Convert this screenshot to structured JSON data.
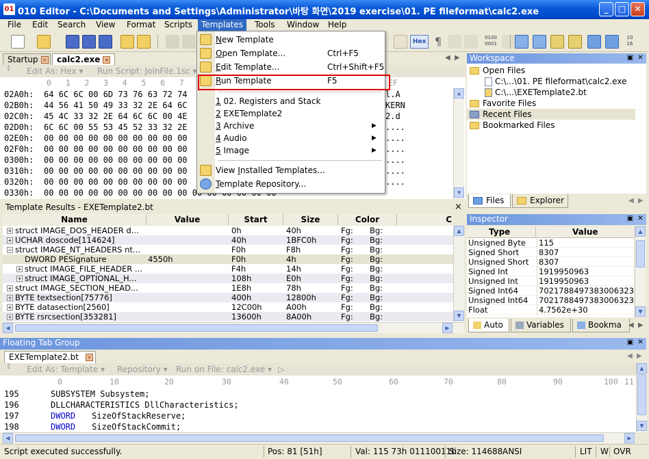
{
  "window": {
    "title": "010 Editor - C:\\Documents and Settings\\Administrator\\바탕 화면\\2019 exercise\\01. PE fileformat\\calc2.exe",
    "controls": {
      "min": "_",
      "max": "□",
      "close": "✕"
    }
  },
  "menubar": [
    "File",
    "Edit",
    "Search",
    "View",
    "Format",
    "Scripts",
    "Templates",
    "Tools",
    "Window",
    "Help"
  ],
  "toolbar": {
    "hex_label": "Hex"
  },
  "editor": {
    "tabs": [
      "Startup",
      "calc2.exe"
    ],
    "bar": {
      "edit_as": "Edit As: Hex ▾",
      "run_script": "Run Script: JoinFile.1sc ▾"
    },
    "columns": "0   1   2   3   4   5   6   7   8   9   A   B   C   D   E   F",
    "columns_text": "EF",
    "rows": [
      {
        "addr": "02A0h:",
        "bytes": "64 6C 6C 00 6D 73 76 63 72 74",
        "text": "l.A"
      },
      {
        "addr": "02B0h:",
        "bytes": "44 56 41 50 49 33 32 2E 64 6C",
        "text": "KERN"
      },
      {
        "addr": "02C0h:",
        "bytes": "45 4C 33 32 2E 64 6C 6C 00 4E",
        "text": "2.d"
      },
      {
        "addr": "02D0h:",
        "bytes": "6C 6C 00 55 53 45 52 33 32 2E",
        "text": "...."
      },
      {
        "addr": "02E0h:",
        "bytes": "00 00 00 00 00 00 00 00 00 00",
        "text": "...."
      },
      {
        "addr": "02F0h:",
        "bytes": "00 00 00 00 00 00 00 00 00 00",
        "text": "...."
      },
      {
        "addr": "0300h:",
        "bytes": "00 00 00 00 00 00 00 00 00 00",
        "text": "...."
      },
      {
        "addr": "0310h:",
        "bytes": "00 00 00 00 00 00 00 00 00 00",
        "text": "...."
      },
      {
        "addr": "0320h:",
        "bytes": "00 00 00 00 00 00 00 00 00 00",
        "text": "...."
      },
      {
        "addr": "0330h:",
        "bytes": "00 00 00 00 00 00 00 00 00 00 00 00 00 00 00 00",
        "text": ""
      }
    ]
  },
  "templates_menu": {
    "items": [
      {
        "label": "New Template",
        "mnemonic": "N",
        "shortcut": ""
      },
      {
        "label": "Open Template...",
        "mnemonic": "O",
        "shortcut": "Ctrl+F5"
      },
      {
        "label": "Edit Template...",
        "mnemonic": "E",
        "shortcut": "Ctrl+Shift+F5"
      },
      {
        "label": "Run Template",
        "mnemonic": "R",
        "shortcut": "F5"
      }
    ],
    "recent": [
      {
        "num": "1",
        "label": " 02. Registers and Stack"
      },
      {
        "num": "2",
        "label": " EXETemplate2"
      },
      {
        "num": "3",
        "label": " Archive"
      },
      {
        "num": "4",
        "label": " Audio"
      },
      {
        "num": "5",
        "label": " Image"
      }
    ],
    "bottom": [
      {
        "label": "View Installed Templates...",
        "mnemonic": "I"
      },
      {
        "label": "Template Repository...",
        "mnemonic": "T"
      }
    ]
  },
  "template_results": {
    "title": "Template Results - EXETemplate2.bt",
    "close": "×",
    "columns": [
      "Name",
      "Value",
      "Start",
      "Size",
      "Color",
      "C"
    ],
    "rows": [
      {
        "expander": "+",
        "name": "struct IMAGE_DOS_HEADER d...",
        "value": "",
        "start": "0h",
        "size": "40h",
        "fg": "Fg:",
        "bg": "Bg:",
        "indent": 0
      },
      {
        "expander": "+",
        "name": "UCHAR doscode[114624]",
        "value": "",
        "start": "40h",
        "size": "1BFC0h",
        "fg": "Fg:",
        "bg": "Bg:",
        "indent": 0
      },
      {
        "expander": "−",
        "name": "struct IMAGE_NT_HEADERS nt...",
        "value": "",
        "start": "F0h",
        "size": "F8h",
        "fg": "Fg:",
        "bg": "Bg:",
        "indent": 0
      },
      {
        "expander": "",
        "name": "DWORD PESignature",
        "value": "4550h",
        "start": "F0h",
        "size": "4h",
        "fg": "Fg:",
        "bg": "Bg:",
        "indent": 1
      },
      {
        "expander": "+",
        "name": "struct IMAGE_FILE_HEADER ...",
        "value": "",
        "start": "F4h",
        "size": "14h",
        "fg": "Fg:",
        "bg": "Bg:",
        "indent": 1
      },
      {
        "expander": "+",
        "name": "struct IMAGE_OPTIONAL_H...",
        "value": "",
        "start": "108h",
        "size": "E0h",
        "fg": "Fg:",
        "bg": "Bg:",
        "indent": 1
      },
      {
        "expander": "+",
        "name": "struct IMAGE_SECTION_HEAD...",
        "value": "",
        "start": "1E8h",
        "size": "78h",
        "fg": "Fg:",
        "bg": "Bg:",
        "indent": 0
      },
      {
        "expander": "+",
        "name": "BYTE textsection[75776]",
        "value": "",
        "start": "400h",
        "size": "12800h",
        "fg": "Fg:",
        "bg": "Bg:",
        "indent": 0
      },
      {
        "expander": "+",
        "name": "BYTE datasection[2560]",
        "value": "",
        "start": "12C00h",
        "size": "A00h",
        "fg": "Fg:",
        "bg": "Bg:",
        "indent": 0
      },
      {
        "expander": "+",
        "name": "BYTE rsrcsection[353281]",
        "value": "",
        "start": "13600h",
        "size": "8A00h",
        "fg": "Fg:",
        "bg": "Bg:",
        "indent": 0
      }
    ]
  },
  "workspace": {
    "title": "Workspace",
    "items": [
      {
        "label": "Open Files",
        "kind": "folder",
        "indent": 0
      },
      {
        "label": "C:\\...\\01. PE fileformat\\calc2.exe",
        "kind": "file",
        "indent": 1
      },
      {
        "label": "C:\\...\\EXETemplate2.bt",
        "kind": "file",
        "indent": 1
      },
      {
        "label": "Favorite Files",
        "kind": "folder",
        "indent": 0
      },
      {
        "label": "Recent Files",
        "kind": "folder",
        "indent": 0
      },
      {
        "label": "Bookmarked Files",
        "kind": "folder",
        "indent": 0
      }
    ],
    "tabs": [
      "Files",
      "Explorer"
    ]
  },
  "inspector": {
    "title": "Inspector",
    "columns": [
      "Type",
      "Value"
    ],
    "rows": [
      {
        "type": "Unsigned Byte",
        "value": "115"
      },
      {
        "type": "Signed Short",
        "value": "8307"
      },
      {
        "type": "Unsigned Short",
        "value": "8307"
      },
      {
        "type": "Signed Int",
        "value": "1919950963"
      },
      {
        "type": "Unsigned Int",
        "value": "1919950963"
      },
      {
        "type": "Signed Int64",
        "value": "7021788497383006323"
      },
      {
        "type": "Unsigned Int64",
        "value": "7021788497383006323"
      },
      {
        "type": "Float",
        "value": "4.7562e+30"
      }
    ],
    "tabs": [
      "Auto",
      "Variables",
      "Bookma"
    ]
  },
  "floating": {
    "title": "Floating Tab Group",
    "tab": "EXETemplate2.bt",
    "bar": {
      "edit_as": "Edit As: Template ▾",
      "repository": "Repository ▾",
      "run_on": "Run on File: calc2.exe ▾",
      "play": "▷"
    },
    "ruler": [
      "0",
      "10",
      "20",
      "30",
      "40",
      "50",
      "60",
      "70",
      "80",
      "90",
      "100",
      "11"
    ],
    "lines": [
      {
        "num": "195",
        "kw": "",
        "text": "SUBSYSTEM Subsystem;"
      },
      {
        "num": "196",
        "kw": "",
        "text": "DLLCHARACTERISTICS DllCharacteristics;"
      },
      {
        "num": "197",
        "kw": "DWORD",
        "text": "SizeOfStackReserve;"
      },
      {
        "num": "198",
        "kw": "DWORD",
        "text": "SizeOfStackCommit;"
      }
    ]
  },
  "status": {
    "message": "Script executed successfully.",
    "pos": "Pos: 81 [51h]",
    "val": "Val: 115 73h 01110011b",
    "size": "Size: 114688",
    "enc": "ANSI",
    "lit": "LIT",
    "w": "W",
    "ovr": "OVR"
  }
}
